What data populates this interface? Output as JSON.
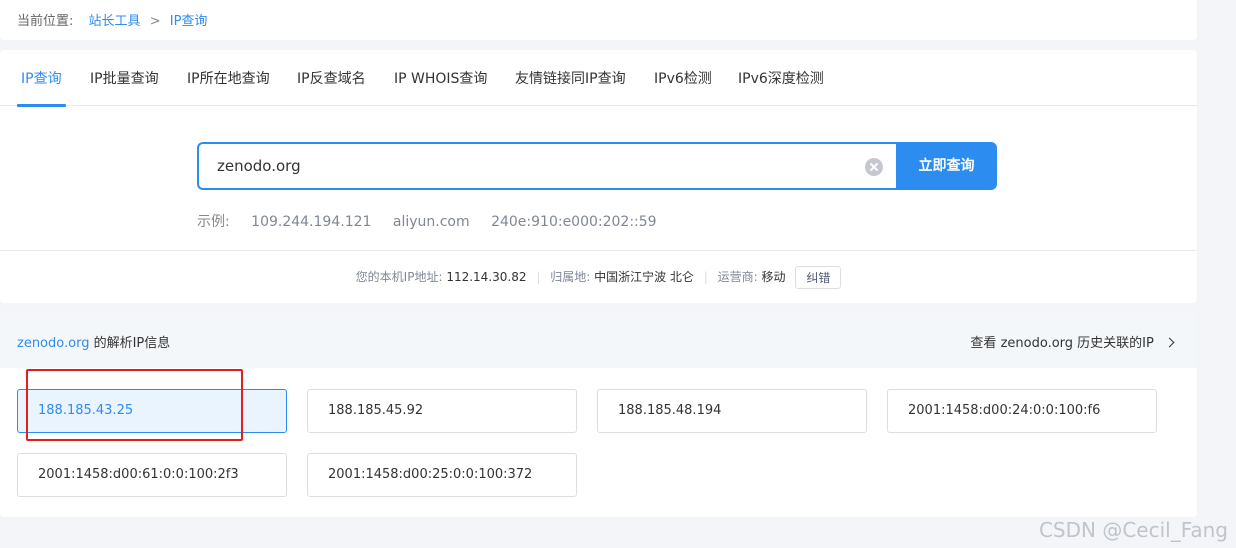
{
  "breadcrumb": {
    "label": "当前位置:",
    "items": [
      "站长工具",
      "IP查询"
    ],
    "separator": ">"
  },
  "tabs": [
    {
      "label": "IP查询",
      "active": true
    },
    {
      "label": "IP批量查询",
      "active": false
    },
    {
      "label": "IP所在地查询",
      "active": false
    },
    {
      "label": "IP反查域名",
      "active": false
    },
    {
      "label": "IP WHOIS查询",
      "active": false
    },
    {
      "label": "友情链接同IP查询",
      "active": false
    },
    {
      "label": "IPv6检测",
      "active": false
    },
    {
      "label": "IPv6深度检测",
      "active": false
    }
  ],
  "search": {
    "value": "zenodo.org",
    "button_label": "立即查询"
  },
  "examples": {
    "label": "示例:",
    "items": [
      "109.244.194.121",
      "aliyun.com",
      "240e:910:e000:202::59"
    ]
  },
  "my_ip": {
    "ip_label": "您的本机IP地址:",
    "ip_value": "112.14.30.82",
    "location_label": "归属地:",
    "location_value": "中国浙江宁波 北仑",
    "isp_label": "运营商:",
    "isp_value": "移动",
    "report_label": "纠错"
  },
  "result": {
    "domain": "zenodo.org",
    "title_suffix": "的解析IP信息",
    "history_prefix": "查看",
    "history_domain": "zenodo.org",
    "history_suffix": "历史关联的IP",
    "ips": [
      "188.185.43.25",
      "188.185.45.92",
      "188.185.48.194",
      "2001:1458:d00:24:0:0:100:f6",
      "2001:1458:d00:61:0:0:100:2f3",
      "2001:1458:d00:25:0:0:100:372"
    ],
    "selected_index": 0
  },
  "colors": {
    "accent": "#2d8cf0",
    "highlight_box": "#e02020",
    "background": "#f3f5f8"
  },
  "watermark": "CSDN @Cecil_Fang"
}
